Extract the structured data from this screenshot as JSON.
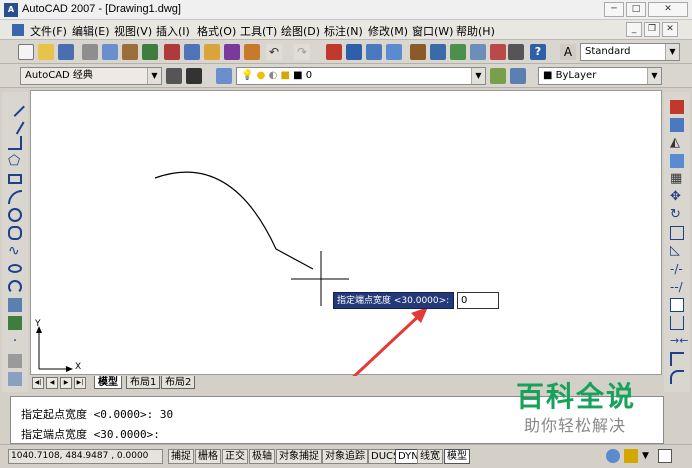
{
  "window": {
    "title": "AutoCAD 2007 - [Drawing1.dwg]",
    "app_icon": "autocad-icon"
  },
  "menu": {
    "items": [
      "文件(F)",
      "编辑(E)",
      "视图(V)",
      "插入(I)",
      "格式(O)",
      "工具(T)",
      "绘图(D)",
      "标注(N)",
      "修改(M)",
      "窗口(W)",
      "帮助(H)"
    ]
  },
  "toolbar": {
    "text_style": "Standard"
  },
  "workspace": {
    "value": "AutoCAD 经典"
  },
  "layer": {
    "current": "0"
  },
  "color": {
    "value": "ByLayer"
  },
  "layout_tabs": [
    "模型",
    "布局1",
    "布局2"
  ],
  "dynamic_input": {
    "prompt": "指定端点宽度 <30.0000>:",
    "value": "0"
  },
  "ucs": {
    "x": "X",
    "y": "Y"
  },
  "command": {
    "line1": "指定起点宽度 <0.0000>: 30",
    "line2": "指定端点宽度 <30.0000>:"
  },
  "status": {
    "coords": "1040.7108, 484.9487 , 0.0000",
    "toggles": [
      "捕捉",
      "栅格",
      "正交",
      "极轴",
      "对象捕捉",
      "对象追踪",
      "DUCS",
      "DYN",
      "线宽",
      "模型"
    ]
  },
  "watermark": {
    "title": "百科全说",
    "subtitle": "助你轻松解决"
  },
  "colors": {
    "dyn_prompt_bg": "#243a78",
    "arrow": "#e53935",
    "watermark": "#17a25b"
  }
}
